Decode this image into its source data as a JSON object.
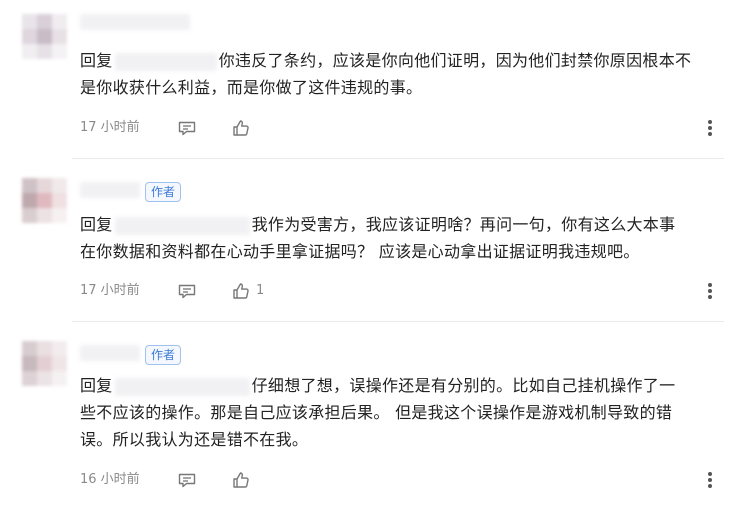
{
  "comments": [
    {
      "reply_prefix": "回复",
      "is_author": false,
      "author_label": "",
      "text_line1": "你违反了条约，应该是你向他们证明，因为他们封禁你原因根本不",
      "text_line2": "是你收获什么利益，而是你做了这件违规的事。",
      "text_line3": "",
      "time": "17 小时前",
      "like_count": "",
      "avatar_colors": [
        "#e9e4ea",
        "#d9cfd8",
        "#f0ecf0",
        "#dfd6de",
        "#c9bcc7",
        "#e7e1e6",
        "#f1eef1",
        "#e6e1e6",
        "#f4f2f4"
      ]
    },
    {
      "reply_prefix": "回复",
      "is_author": true,
      "author_label": "作者",
      "text_line1": "我作为受害方，我应该证明啥？再问一句，你有这么大本事",
      "text_line2": "在你数据和资料都在心动手里拿证据吗？ 应该是心动拿出证据证明我违规吧。",
      "text_line3": "",
      "time": "17 小时前",
      "like_count": "1",
      "avatar_colors": [
        "#cfc2c6",
        "#e6d8da",
        "#f1e9ea",
        "#bfa9ae",
        "#e0b9bf",
        "#f0e0e2",
        "#d9cdd0",
        "#ece2e4",
        "#f6f0f1"
      ]
    },
    {
      "reply_prefix": "回复",
      "is_author": true,
      "author_label": "作者",
      "text_line1": "仔细想了想，误操作还是有分别的。比如自己挂机操作了一",
      "text_line2": "些不应该的操作。那是自己应该承担后果。 但是我这个误操作是游戏机制导致的错",
      "text_line3": "误。所以我认为还是错不在我。",
      "time": "16 小时前",
      "like_count": "",
      "avatar_colors": [
        "#d7cdd0",
        "#eadfe1",
        "#f2ecee",
        "#c7b9bd",
        "#e3cfd3",
        "#efe5e7",
        "#ddd2d5",
        "#ebe3e5",
        "#f5f1f2"
      ]
    }
  ],
  "icons": {
    "reply": "comment-icon",
    "like": "thumbs-up-icon",
    "more": "more-vertical-icon"
  },
  "colors": {
    "meta_text": "#8a8a8a",
    "author_badge": "#3b7bd6",
    "divider": "#ebebeb"
  }
}
